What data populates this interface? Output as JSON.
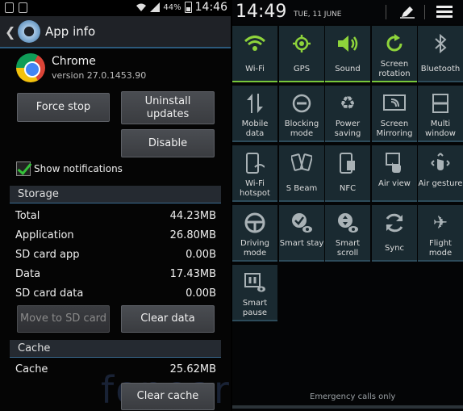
{
  "left": {
    "statusbar": {
      "battery": "44%",
      "time": "14:46"
    },
    "actionbar": {
      "title": "App info"
    },
    "app": {
      "name": "Chrome",
      "version": "version 27.0.1453.90"
    },
    "buttons": {
      "force_stop": "Force stop",
      "uninstall": "Uninstall updates",
      "disable": "Disable",
      "move_to_sd": "Move to SD card",
      "clear_data": "Clear data",
      "clear_cache": "Clear cache"
    },
    "show_notifications": {
      "label": "Show notifications",
      "checked": true
    },
    "storage": {
      "header": "Storage",
      "rows": [
        {
          "label": "Total",
          "value": "44.23MB"
        },
        {
          "label": "Application",
          "value": "26.80MB"
        },
        {
          "label": "SD card app",
          "value": "0.00B"
        },
        {
          "label": "Data",
          "value": "17.43MB"
        },
        {
          "label": "SD card data",
          "value": "0.00B"
        }
      ]
    },
    "cache": {
      "header": "Cache",
      "rows": [
        {
          "label": "Cache",
          "value": "25.62MB"
        }
      ]
    },
    "watermark": "fonearena"
  },
  "right": {
    "time": "14:49",
    "date": "TUE, 11 JUNE",
    "tiles": [
      {
        "label": "Wi-Fi",
        "icon": "wifi-icon",
        "on": true
      },
      {
        "label": "GPS",
        "icon": "gps-icon",
        "on": true
      },
      {
        "label": "Sound",
        "icon": "sound-icon",
        "on": true
      },
      {
        "label": "Screen rotation",
        "icon": "screen-rotation-icon",
        "on": true
      },
      {
        "label": "Bluetooth",
        "icon": "bluetooth-icon",
        "on": false
      },
      {
        "label": "Mobile data",
        "icon": "mobile-data-icon",
        "on": false
      },
      {
        "label": "Blocking mode",
        "icon": "blocking-mode-icon",
        "on": false
      },
      {
        "label": "Power saving",
        "icon": "power-saving-icon",
        "on": false
      },
      {
        "label": "Screen Mirroring",
        "icon": "screen-mirroring-icon",
        "on": false
      },
      {
        "label": "Multi window",
        "icon": "multi-window-icon",
        "on": false
      },
      {
        "label": "Wi-Fi hotspot",
        "icon": "wifi-hotspot-icon",
        "on": false
      },
      {
        "label": "S Beam",
        "icon": "s-beam-icon",
        "on": false
      },
      {
        "label": "NFC",
        "icon": "nfc-icon",
        "on": false
      },
      {
        "label": "Air view",
        "icon": "air-view-icon",
        "on": false
      },
      {
        "label": "Air gesture",
        "icon": "air-gesture-icon",
        "on": false
      },
      {
        "label": "Driving mode",
        "icon": "driving-mode-icon",
        "on": false
      },
      {
        "label": "Smart stay",
        "icon": "smart-stay-icon",
        "on": false
      },
      {
        "label": "Smart scroll",
        "icon": "smart-scroll-icon",
        "on": false
      },
      {
        "label": "Sync",
        "icon": "sync-icon",
        "on": false
      },
      {
        "label": "Flight mode",
        "icon": "flight-mode-icon",
        "on": false
      },
      {
        "label": "Smart pause",
        "icon": "smart-pause-icon",
        "on": false
      }
    ],
    "emergency": "Emergency calls only",
    "colors": {
      "active": "#8ed43b",
      "tile_bg": "#1a2a31",
      "accent_blue": "#3b6c92"
    }
  }
}
